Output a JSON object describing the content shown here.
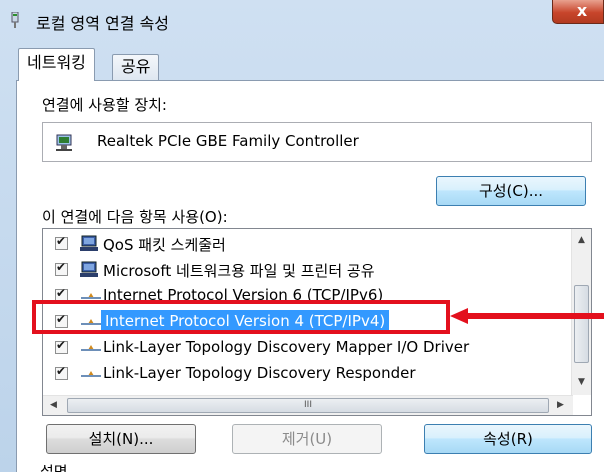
{
  "window": {
    "title": "로컬 영역 연결 속성",
    "close_label": "x"
  },
  "tabs": [
    {
      "label": "네트워킹",
      "active": true
    },
    {
      "label": "공유",
      "active": false
    }
  ],
  "device": {
    "label": "연결에 사용할 장치:",
    "name": "Realtek PCIe GBE Family Controller",
    "configure_button": "구성(C)..."
  },
  "items": {
    "label": "이 연결에 다음 항목 사용(O):",
    "list": [
      {
        "text": "QoS 패킷 스케줄러",
        "checked": true,
        "icon": "computer-icon"
      },
      {
        "text": "Microsoft 네트워크용 파일 및 프린터 공유",
        "checked": true,
        "icon": "computer-icon"
      },
      {
        "text": "Internet Protocol Version 6 (TCP/IPv6)",
        "checked": true,
        "icon": "network-protocol-icon"
      },
      {
        "text": "Internet Protocol Version 4 (TCP/IPv4)",
        "checked": true,
        "icon": "network-protocol-icon",
        "selected": true
      },
      {
        "text": "Link-Layer Topology Discovery Mapper I/O Driver",
        "checked": true,
        "icon": "network-protocol-icon"
      },
      {
        "text": "Link-Layer Topology Discovery Responder",
        "checked": true,
        "icon": "network-protocol-icon"
      }
    ],
    "scroll_grip": "III"
  },
  "buttons": {
    "install": "설치(N)...",
    "remove": "제거(U)",
    "properties": "속성(R)"
  },
  "description_label": "설명",
  "colors": {
    "highlight": "#e3101d",
    "selection": "#3399ff",
    "title_bg": "#cfe0f2"
  }
}
